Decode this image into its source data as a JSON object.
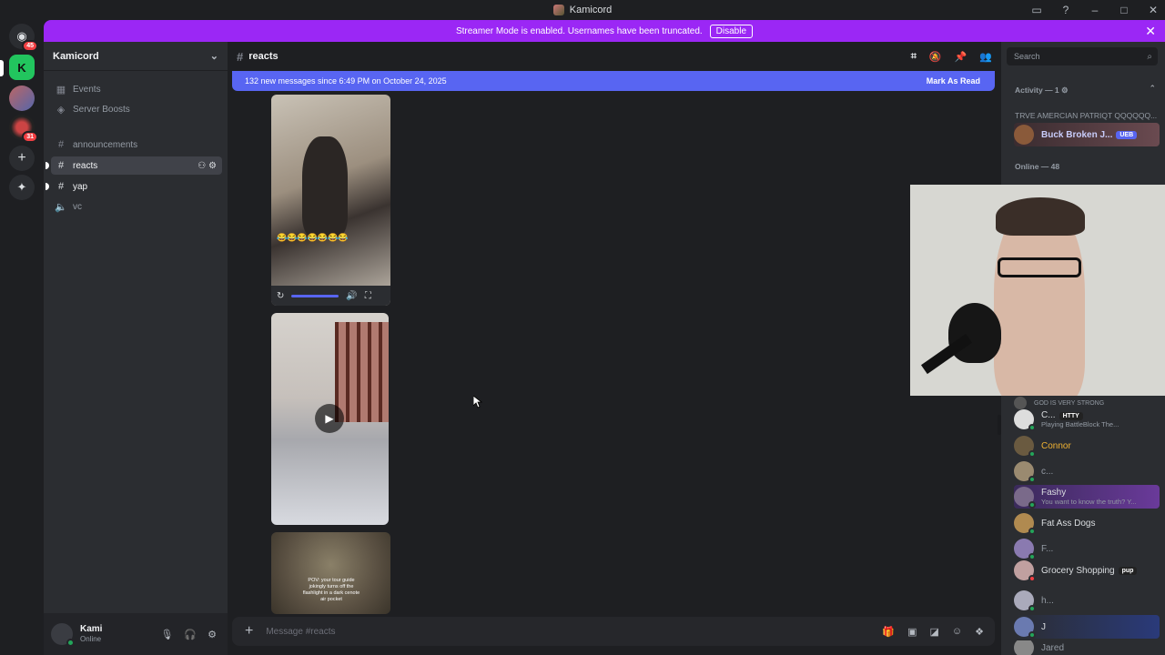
{
  "window": {
    "title": "Kamicord"
  },
  "banner": {
    "text": "Streamer Mode is enabled. Usernames have been truncated.",
    "disable_label": "Disable"
  },
  "servers": [
    {
      "name": "direct-messages",
      "badge": "45"
    },
    {
      "name": "server-green",
      "badge": ""
    },
    {
      "name": "server-kamicord",
      "badge": ""
    },
    {
      "name": "server-wheel",
      "badge": "31"
    }
  ],
  "guild": {
    "name": "Kamicord"
  },
  "sidebar": {
    "events": "Events",
    "boosts": "Server Boosts",
    "channels": [
      {
        "name": "announcements",
        "type": "text"
      },
      {
        "name": "reacts",
        "type": "text"
      },
      {
        "name": "yap",
        "type": "text"
      },
      {
        "name": "vc",
        "type": "voice"
      }
    ]
  },
  "user": {
    "name": "Kami",
    "status": "Online"
  },
  "chat": {
    "channel": "reacts",
    "new_messages": "132 new messages since 6:49 PM on October 24, 2025",
    "mark_as_read": "Mark As Read",
    "video1_caption": "😂😂😂😂😂😂😂",
    "video3_caption": "POV: your tour guide jokingly turns off the flashlight in a dark cenote air pocket",
    "composer_placeholder": "Message #reacts"
  },
  "members": {
    "search_placeholder": "Search",
    "activity_label": "Activity — 1",
    "activity_title": "TRVE AMERCIAN PATRIQT QQQQQQ...",
    "activity_user": "Buck Broken J...",
    "activity_tag": "UEB",
    "online_label": "Online — 48",
    "list": [
      {
        "name": "GOD IS VERY STRONG",
        "sub": ""
      },
      {
        "name": "C...",
        "tag": "HTTY",
        "sub": "Playing BattleBlock The..."
      },
      {
        "name": "Connor",
        "sub": ""
      },
      {
        "name": "c...",
        "sub": ""
      },
      {
        "name": "Fashy",
        "sub": "You want to know the truth? Y..."
      },
      {
        "name": "Fat Ass Dogs",
        "sub": ""
      },
      {
        "name": "F...",
        "sub": ""
      },
      {
        "name": "Grocery Shopping",
        "tag": "pup",
        "sub": ""
      },
      {
        "name": "h...",
        "sub": ""
      },
      {
        "name": "J",
        "sub": ""
      },
      {
        "name": "Jared",
        "sub": ""
      }
    ]
  },
  "colors": {
    "accent": "#5865f2",
    "streamer_banner": "#9b27f5",
    "online": "#23a55a",
    "connor": "#f0b232"
  }
}
